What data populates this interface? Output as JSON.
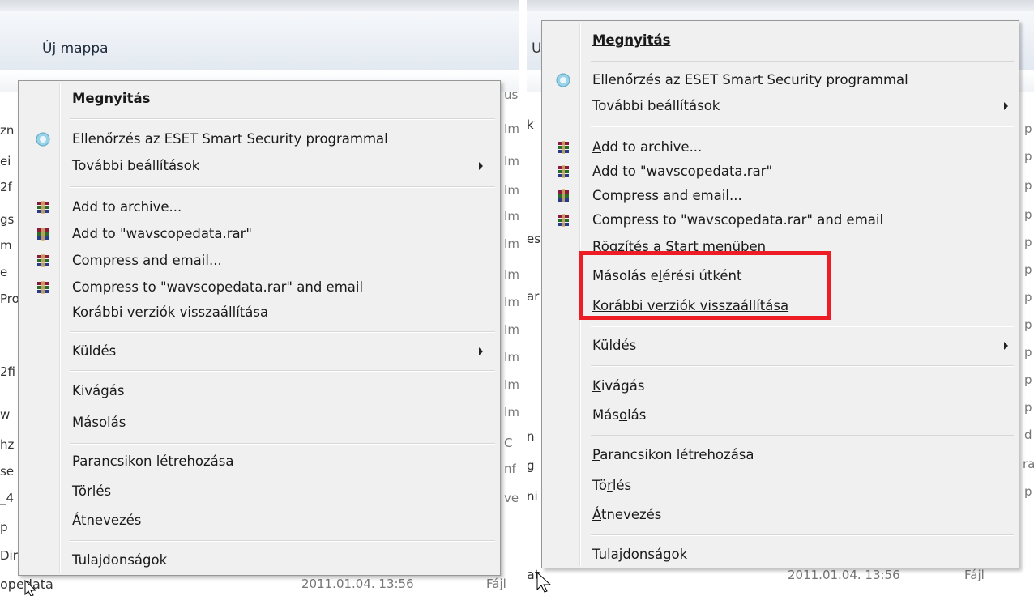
{
  "left": {
    "toolbar": {
      "new_folder": "Új mappa"
    },
    "background": {
      "fragments_left": [
        "zn",
        "ei",
        "2f",
        "gs",
        "m",
        "e",
        "Pro",
        "",
        "2fi",
        "w",
        "hz",
        "se",
        "_4",
        "p",
        "Dir"
      ],
      "fragments_right": [
        "us",
        "Im",
        "Im",
        "Im",
        "Im",
        "Im",
        "Im",
        "Im",
        "Im",
        "Im",
        "Im",
        "Im",
        "C",
        "nf",
        "ve"
      ],
      "bottom_name": "opedata",
      "bottom_date": "2011.01.04. 13:56",
      "bottom_type": "Fájl"
    },
    "menu": {
      "open": "Megnyitás",
      "eset": "Ellenőrzés az ESET Smart Security programmal",
      "more_settings": "További beállítások",
      "add_archive": "Add to archive...",
      "add_to_rar": "Add to \"wavscopedata.rar\"",
      "compress_email": "Compress and email...",
      "compress_rar_email": "Compress to \"wavscopedata.rar\" and email",
      "restore_versions": "Korábbi verziók visszaállítása",
      "send_to": "Küldés",
      "cut": "Kivágás",
      "copy": "Másolás",
      "create_shortcut": "Parancsikon létrehozása",
      "delete": "Törlés",
      "rename": "Átnevezés",
      "properties": "Tulajdonságok"
    }
  },
  "right": {
    "background": {
      "fragments_left": [
        "U",
        "k",
        "es",
        "ar",
        "n",
        "g",
        "ni"
      ],
      "fragments_right": [
        "p",
        "p",
        "p",
        "p",
        "p",
        "p",
        "p",
        "p",
        "p",
        "p",
        "p",
        "d",
        "ra",
        "p"
      ],
      "bottom_name": "at",
      "bottom_date": "2011.01.04. 13:56",
      "bottom_type": "Fájl"
    },
    "menu": {
      "open": "Megnyitás",
      "eset": "Ellenőrzés az ESET Smart Security programmal",
      "more_settings": "További beállítások",
      "add_archive": {
        "a": "A",
        "b": "dd to archive..."
      },
      "add_to_rar": {
        "a": "Add ",
        "b": "t",
        "c": "o \"wavscopedata.rar\""
      },
      "compress_email": "Compress and email...",
      "compress_rar_email": "Compress to \"wavscopedata.rar\" and email",
      "pin_start": "Rögzítés a Start menüben",
      "copy_as_path": {
        "a": "Másolás e",
        "b": "l",
        "c": "érési útként"
      },
      "restore_versions": "Korábbi verziók visszaállítása",
      "send_to": {
        "a": "Kül",
        "b": "d",
        "c": "és"
      },
      "cut": {
        "a": "K",
        "b": "ivágás"
      },
      "copy": {
        "a": "Más",
        "b": "o",
        "c": "lás"
      },
      "create_shortcut": {
        "a": "P",
        "b": "arancsikon létrehozása"
      },
      "delete": {
        "a": "Tö",
        "b": "r",
        "c": "lés"
      },
      "rename": {
        "a": "Á",
        "b": "tnevezés"
      },
      "properties": {
        "a": "T",
        "b": "u",
        "c": "lajdonságok"
      }
    }
  },
  "colors": {
    "highlight_box": "#ee1c24",
    "menu_bg": "#f0f0f0"
  }
}
